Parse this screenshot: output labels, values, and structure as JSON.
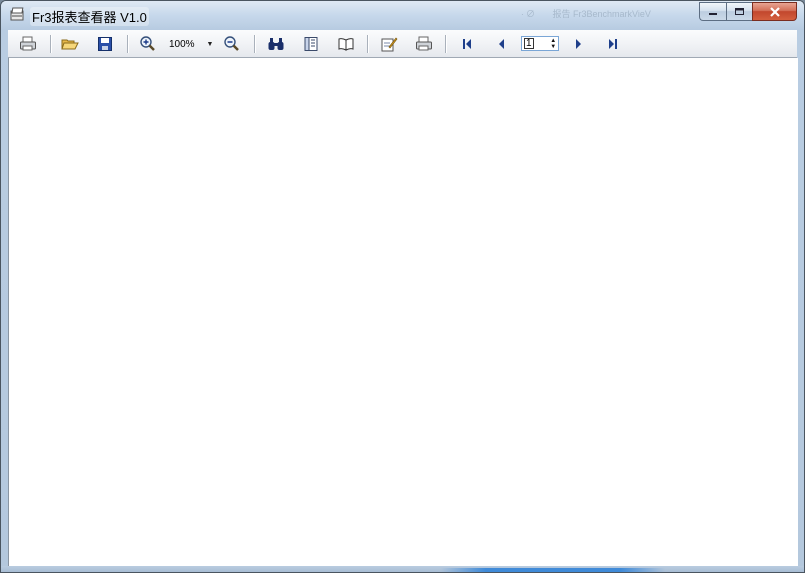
{
  "window": {
    "title": "Fr3报表查看器 V1.0",
    "ghost_text": "∙ ∅       报告 Fr3BenchmarkVieV"
  },
  "toolbar": {
    "buttons": [
      {
        "name": "print-icon",
        "tooltip": ""
      },
      {
        "name": "open-folder-icon"
      },
      {
        "name": "save-icon"
      },
      {
        "name": "zoom-in-icon"
      },
      {
        "name": "zoom-out-icon"
      },
      {
        "name": "find-icon"
      },
      {
        "name": "outline-icon"
      },
      {
        "name": "book-icon"
      },
      {
        "name": "edit-icon"
      },
      {
        "name": "print-preview-icon"
      },
      {
        "name": "first-page-icon"
      },
      {
        "name": "prev-page-icon"
      },
      {
        "name": "next-page-icon"
      },
      {
        "name": "last-page-icon"
      }
    ],
    "zoom_value": "100%",
    "page_value": "1"
  },
  "colors": {
    "accent": "#3f8ad8",
    "close_red": "#c2472d",
    "icon_blue": "#1e3f8a"
  }
}
